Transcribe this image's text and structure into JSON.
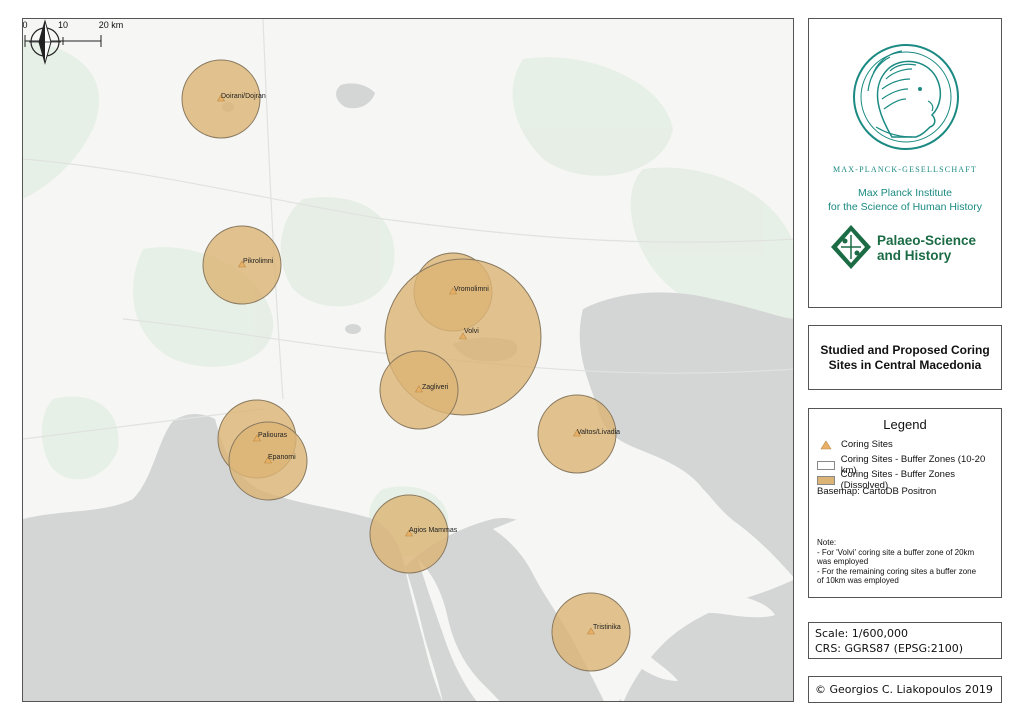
{
  "map": {
    "sites": [
      {
        "name": "Doirani/Dojran",
        "label": "Doirani/Dojran"
      },
      {
        "name": "Pikrolimni",
        "label": "Pikrolimni"
      },
      {
        "name": "Vromolimni",
        "label": "Vromolimni"
      },
      {
        "name": "Volvi",
        "label": "Volvi"
      },
      {
        "name": "Zagliveri",
        "label": "Zagliveri"
      },
      {
        "name": "Paliouras",
        "label": "Paliouras"
      },
      {
        "name": "Epanomi",
        "label": "Epanomi"
      },
      {
        "name": "Valtos/Livadia",
        "label": "Valtos/Livadia"
      },
      {
        "name": "Agios Mammas",
        "label": "Agios Mammas"
      },
      {
        "name": "Tristinika",
        "label": "Tristinika"
      }
    ],
    "scalebar": {
      "labels": [
        "0",
        "10",
        "20 km"
      ]
    },
    "colors": {
      "buffer_fill": "#dcb476",
      "buffer_stroke": "#8a7a60",
      "site_marker": "#e8b066",
      "sea": "#d4d6d6",
      "land": "#f6f7f5",
      "green": "#e4ede2"
    }
  },
  "logos": {
    "mpg_name": "MAX-PLANCK-GESELLSCHAFT",
    "institute_line1": "Max Planck Institute",
    "institute_line2": "for the Science of Human History",
    "paleo_line1": "Palaeo-Science",
    "paleo_line2": "and History",
    "colors": {
      "mpg_teal": "#1a8a82",
      "paleo_green": "#1b6b45"
    }
  },
  "title": "Studied and Proposed Coring Sites in Central Macedonia",
  "legend": {
    "title": "Legend",
    "items": [
      {
        "label": "Coring Sites",
        "icon": "triangle-marker"
      },
      {
        "label": "Coring Sites - Buffer Zones (10-20 km)",
        "icon": "empty-box"
      },
      {
        "label": "Coring Sites - Buffer Zones (Dissolved)",
        "icon": "filled-box"
      }
    ],
    "basemap": "Basemap: CartoDB Positron",
    "note_title": "Note:",
    "note_lines": [
      "- For 'Volvi' coring site a buffer zone of 20km",
      "was employed",
      "- For the remaining coring sites a buffer zone",
      "of 10km was employed"
    ]
  },
  "scale_info": {
    "scale": "Scale: 1/600,000",
    "crs": "CRS: GGRS87 (EPSG:2100)"
  },
  "credit": "© Georgios C. Liakopoulos 2019"
}
